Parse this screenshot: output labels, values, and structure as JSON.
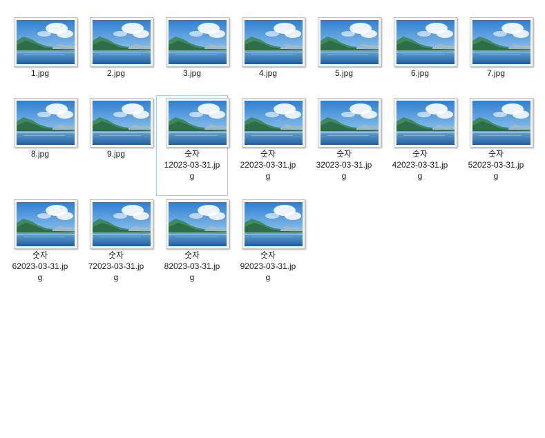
{
  "files": [
    {
      "name": "1.jpg",
      "icon": "landscape-image-thumbnail",
      "selected": false
    },
    {
      "name": "2.jpg",
      "icon": "landscape-image-thumbnail",
      "selected": false
    },
    {
      "name": "3.jpg",
      "icon": "landscape-image-thumbnail",
      "selected": false
    },
    {
      "name": "4.jpg",
      "icon": "landscape-image-thumbnail",
      "selected": false
    },
    {
      "name": "5.jpg",
      "icon": "landscape-image-thumbnail",
      "selected": false
    },
    {
      "name": "6.jpg",
      "icon": "landscape-image-thumbnail",
      "selected": false
    },
    {
      "name": "7.jpg",
      "icon": "landscape-image-thumbnail",
      "selected": false
    },
    {
      "name": "8.jpg",
      "icon": "landscape-image-thumbnail",
      "selected": false
    },
    {
      "name": "9.jpg",
      "icon": "landscape-image-thumbnail",
      "selected": false
    },
    {
      "name": "숫자12023-03-31.jpg",
      "icon": "landscape-image-thumbnail",
      "selected": true
    },
    {
      "name": "숫자22023-03-31.jpg",
      "icon": "landscape-image-thumbnail",
      "selected": false
    },
    {
      "name": "숫자32023-03-31.jpg",
      "icon": "landscape-image-thumbnail",
      "selected": false
    },
    {
      "name": "숫자42023-03-31.jpg",
      "icon": "landscape-image-thumbnail",
      "selected": false
    },
    {
      "name": "숫자52023-03-31.jpg",
      "icon": "landscape-image-thumbnail",
      "selected": false
    },
    {
      "name": "숫자62023-03-31.jpg",
      "icon": "landscape-image-thumbnail",
      "selected": false
    },
    {
      "name": "숫자72023-03-31.jpg",
      "icon": "landscape-image-thumbnail",
      "selected": false
    },
    {
      "name": "숫자82023-03-31.jpg",
      "icon": "landscape-image-thumbnail",
      "selected": false
    },
    {
      "name": "숫자92023-03-31.jpg",
      "icon": "landscape-image-thumbnail",
      "selected": false
    }
  ],
  "colors": {
    "selection_border": "#99d1ff",
    "label_text": "#1a1a1a"
  }
}
